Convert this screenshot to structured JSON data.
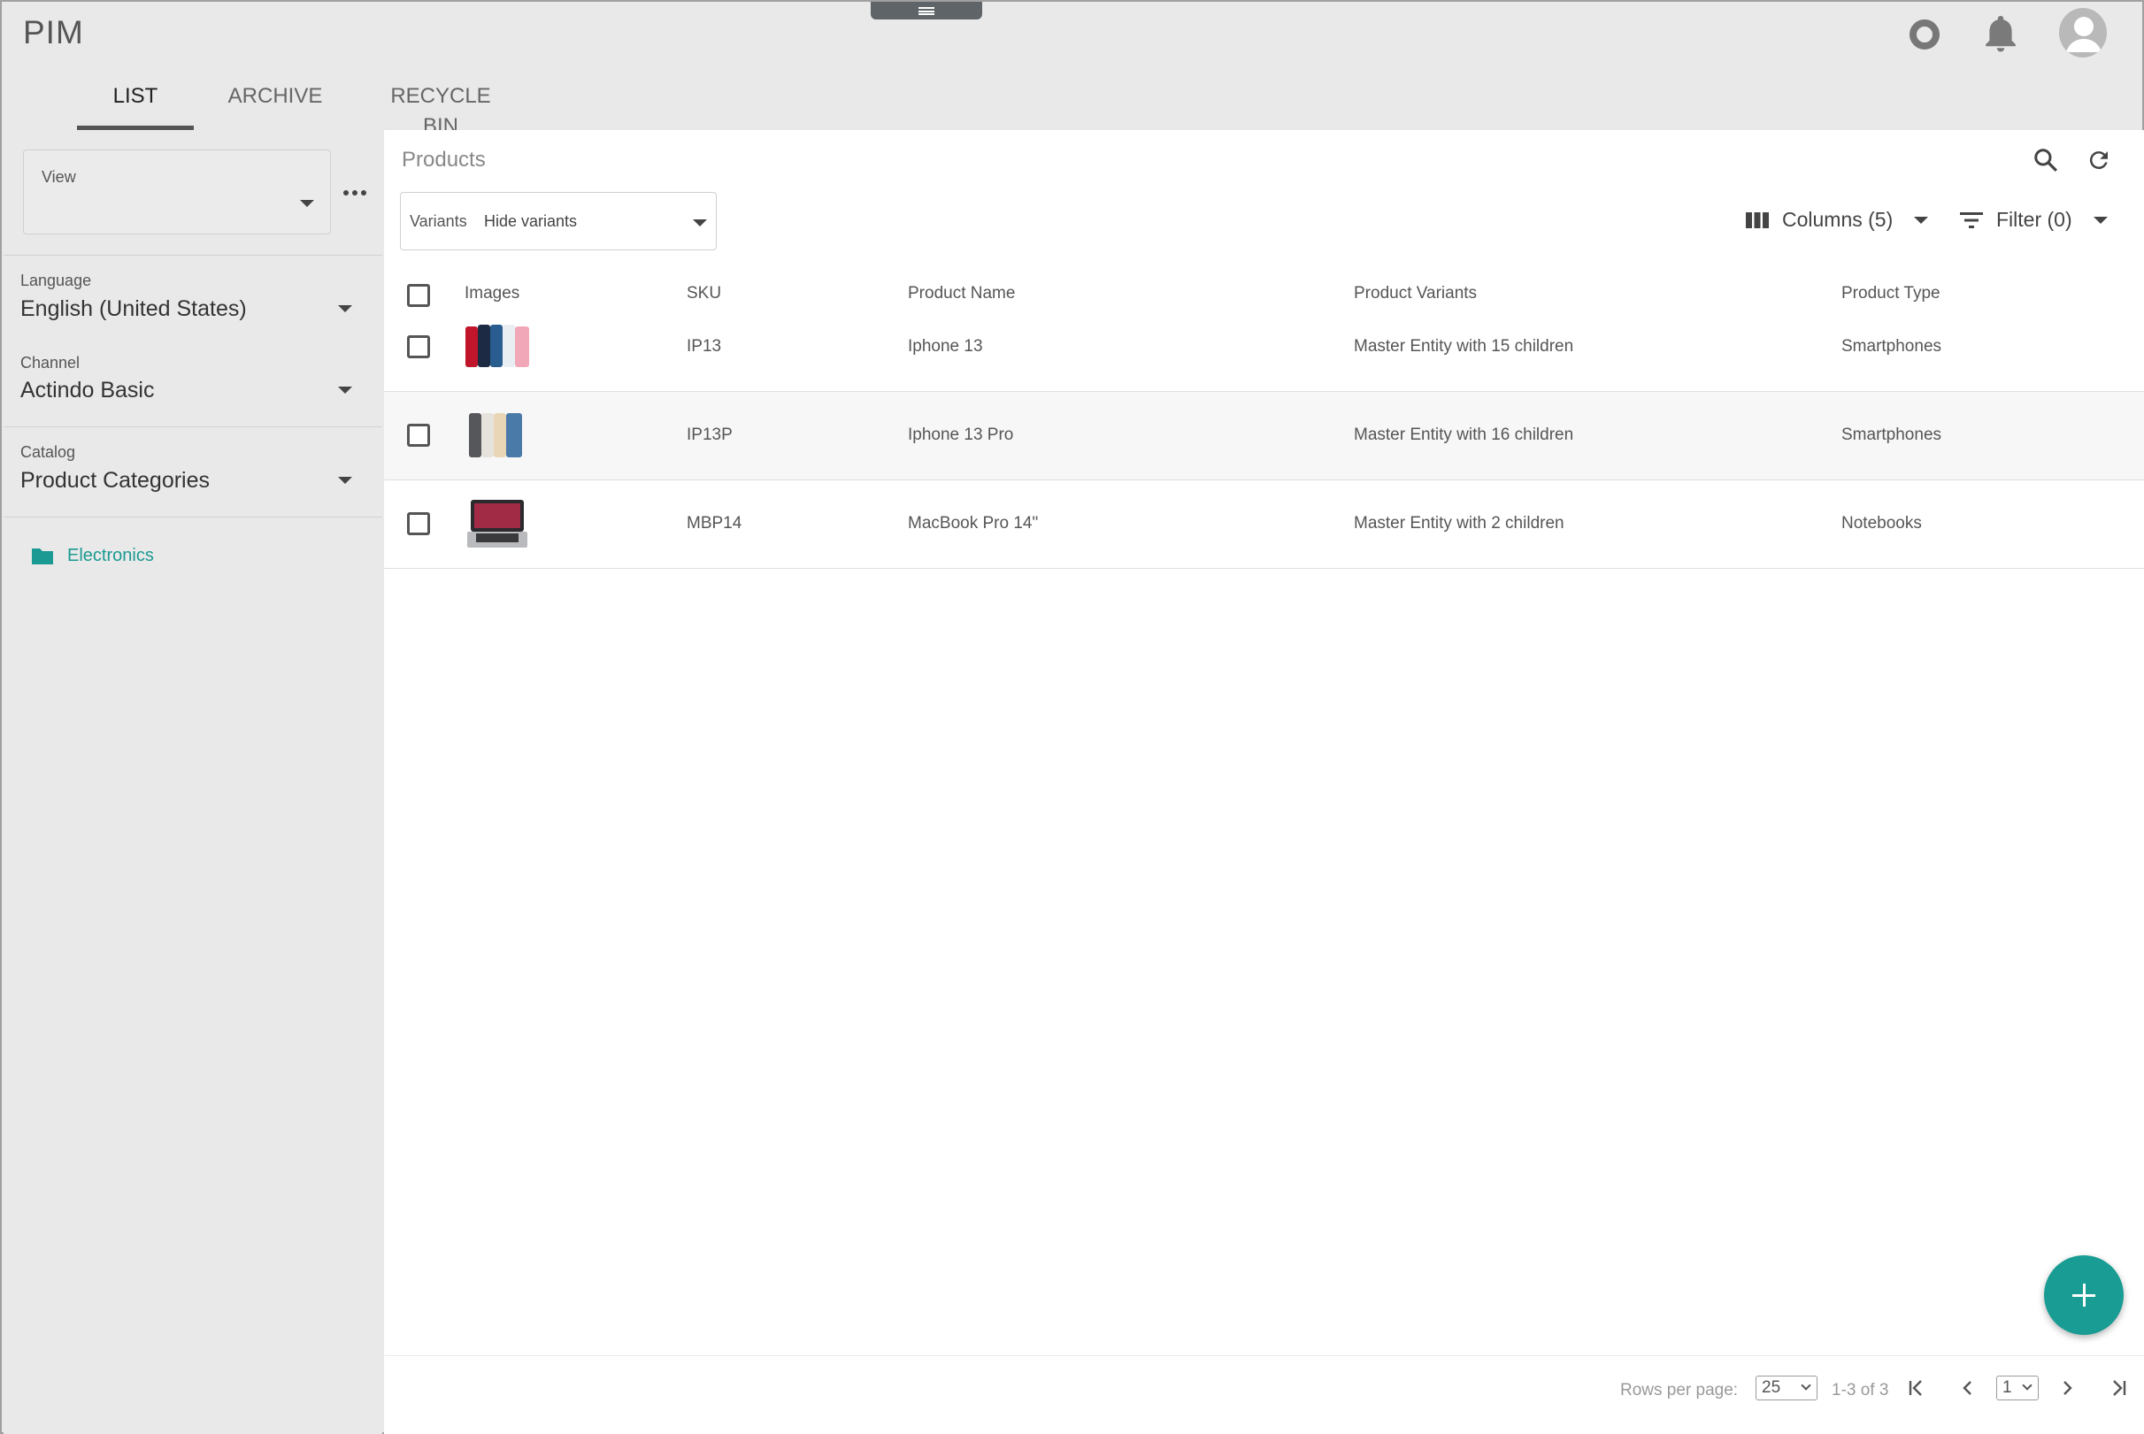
{
  "app": {
    "title": "PIM"
  },
  "tabs": [
    {
      "label": "LIST",
      "active": true
    },
    {
      "label": "ARCHIVE",
      "active": false
    },
    {
      "label": "RECYCLE BIN",
      "active": false
    }
  ],
  "sidebar": {
    "view": {
      "label": "View",
      "value": ""
    },
    "language": {
      "label": "Language",
      "value": "English (United States)"
    },
    "channel": {
      "label": "Channel",
      "value": "Actindo Basic"
    },
    "catalog": {
      "label": "Catalog",
      "value": "Product Categories"
    },
    "tree": [
      {
        "label": "Electronics",
        "icon": "folder-icon"
      }
    ]
  },
  "main": {
    "title": "Products",
    "variants": {
      "label": "Variants",
      "value": "Hide variants"
    },
    "columns_label": "Columns (5)",
    "filter_label": "Filter (0)",
    "table": {
      "headers": [
        "Images",
        "SKU",
        "Product Name",
        "Product Variants",
        "Product Type"
      ],
      "rows": [
        {
          "sku": "IP13",
          "name": "Iphone 13",
          "variants": "Master Entity with 15 children",
          "type": "Smartphones"
        },
        {
          "sku": "IP13P",
          "name": "Iphone 13 Pro",
          "variants": "Master Entity with 16 children",
          "type": "Smartphones"
        },
        {
          "sku": "MBP14",
          "name": "MacBook Pro 14\"",
          "variants": "Master Entity with 2 children",
          "type": "Notebooks"
        }
      ]
    },
    "pager": {
      "rows_per_page_label": "Rows per page:",
      "rows_per_page": "25",
      "range": "1-3 of 3",
      "page": "1"
    }
  },
  "colors": {
    "accent": "#189c93",
    "tree_link": "#1a9a92"
  }
}
